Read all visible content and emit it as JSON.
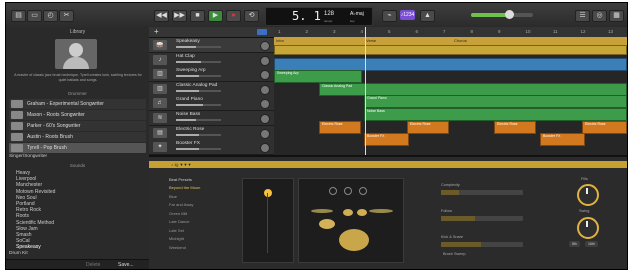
{
  "toolbar": {
    "left_icons": [
      "library-icon",
      "inbox-icon",
      "smart-controls-icon",
      "scissors-icon"
    ],
    "transport": {
      "rewind": "◀◀",
      "forward": "▶▶",
      "stop": "■",
      "play": "▶",
      "record": "●",
      "cycle": "⟲"
    },
    "lcd": {
      "position": "5. 1",
      "tempo": "128",
      "tempo_label": "tempo",
      "key": "A♭maj",
      "key_label": "key"
    },
    "count_in": "♪1234",
    "master_volume_level": 0.62,
    "right_icons": [
      "notepad-icon",
      "loops-icon",
      "browser-icon"
    ]
  },
  "library": {
    "title": "Library",
    "description": "A master of classic jazz brush technique, Tyrell creates lush, swirling textures for quiet ballads and songs.",
    "drummer_header": "Drummer",
    "drummers": [
      "Graham - Experimental Songwriter",
      "Mason - Roots Songwriter",
      "Parker - 60's Songwriter",
      "Austin - Roots Brush",
      "Tyrell - Pop Brush"
    ],
    "selected_drummer": 4,
    "genre": "Singer/Songwriter",
    "sounds_header": "Sounds",
    "sounds": [
      "Heavy",
      "Liverpool",
      "Manchester",
      "Motown Revisited",
      "Neo Soul",
      "Portland",
      "Retro Rock",
      "Roots",
      "Scientific Method",
      "Slow Jam",
      "Smash",
      "SoCal",
      "Speakeasy"
    ],
    "selected_sound": 12,
    "kit": "Drum Kit",
    "footer": {
      "delete": "Delete",
      "save": "Save..."
    }
  },
  "tracks": [
    {
      "name": "Speakeasy",
      "icon": "drums-icon",
      "mix": 0.45
    },
    {
      "name": "Hat Clap",
      "icon": "hat-icon",
      "mix": 0.55
    },
    {
      "name": "Sweeping Arp",
      "icon": "keyboard-icon",
      "mix": 0.5
    },
    {
      "name": "Classic Analog Pad",
      "icon": "keyboard-icon",
      "mix": 0.5
    },
    {
      "name": "Grand Piano",
      "icon": "piano-icon",
      "mix": 0.6
    },
    {
      "name": "Noise Bass",
      "icon": "synth-icon",
      "mix": 0.45
    },
    {
      "name": "Electric Rose",
      "icon": "keys-icon",
      "mix": 0.5
    },
    {
      "name": "Booster FX",
      "icon": "fx-icon",
      "mix": 0.5
    }
  ],
  "ruler": [
    "1",
    "2",
    "3",
    "4",
    "5",
    "6",
    "7",
    "8",
    "9",
    "10",
    "11",
    "12",
    "13"
  ],
  "markers": [
    {
      "label": "Intro"
    },
    {
      "label": "Verse"
    },
    {
      "label": "Chorus"
    }
  ],
  "regions": [
    {
      "label": "Sweeping Arp"
    },
    {
      "label": "Classic Analog Pad"
    },
    {
      "label": "Grand Piano"
    },
    {
      "label": "Noise Bass"
    },
    {
      "label": "Electric Rose"
    },
    {
      "label": "Electric Rose"
    },
    {
      "label": "Electric Rose"
    },
    {
      "label": "Electric Rose"
    },
    {
      "label": "Booster FX"
    },
    {
      "label": "Booster FX"
    }
  ],
  "editor": {
    "header_label": "♪ 1|| ▼▼▼",
    "presets_header": "Beat Presets",
    "presets": [
      "Beyond the Moon",
      "Blue",
      "Far and Away",
      "Green Mill",
      "Late Dance",
      "Late Set",
      "Midnight",
      "Weekend"
    ],
    "selected_preset": 0,
    "pad_level_x": 0.5,
    "controls": {
      "complexity_label": "Complexity",
      "follow_label": "Follow",
      "kick_snare_label": "Kick & Snare",
      "brush_sweep_label": "Brush Sweep",
      "fills_label": "Fills",
      "swing_label": "Swing",
      "swing_8th": "8th",
      "swing_16th": "16th"
    }
  }
}
